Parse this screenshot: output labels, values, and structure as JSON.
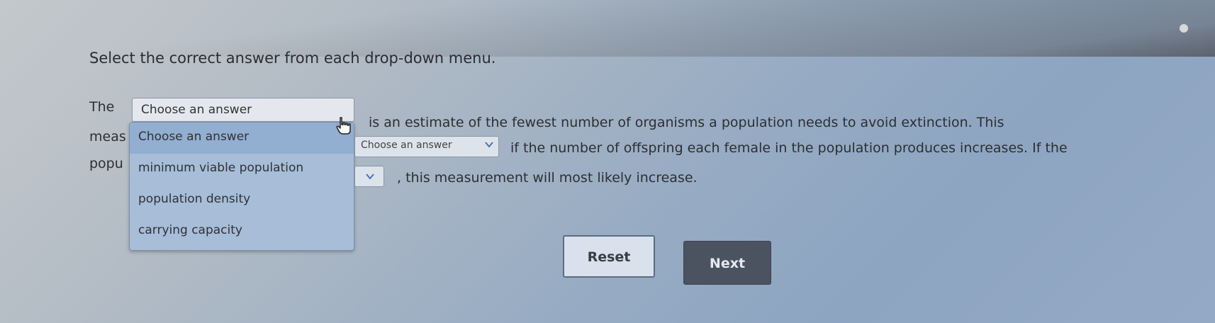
{
  "instruction": "Select the correct answer from each drop-down menu.",
  "passage": {
    "line1_start": "The",
    "line1_end": "is an estimate of the fewest number of organisms a population needs to avoid extinction. This",
    "line2_start": "meas",
    "line2_end": "if the number of offspring each female in the population produces increases. If the",
    "line3_start": "popu",
    "line3_end": ", this measurement will most likely increase."
  },
  "dropdown1": {
    "selected": "Choose an answer",
    "options": [
      "Choose an answer",
      "minimum viable population",
      "population density",
      "carrying capacity"
    ]
  },
  "dropdown2": {
    "selected": "Choose an answer"
  },
  "buttons": {
    "reset": "Reset",
    "next": "Next"
  },
  "icons": {
    "cursor": "hand-pointer-icon",
    "chevron": "chevron-down-icon"
  }
}
